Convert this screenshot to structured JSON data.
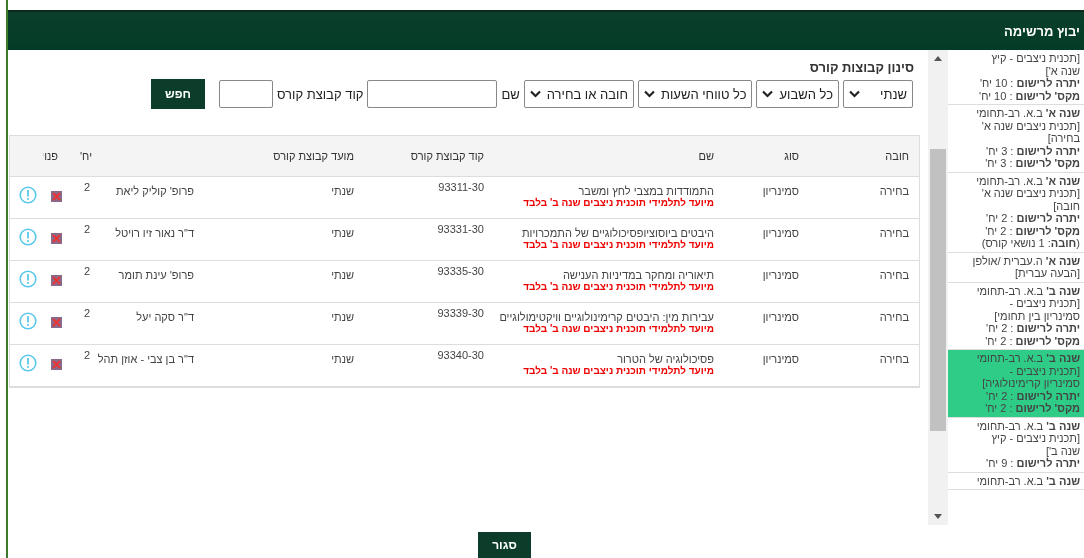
{
  "header": {
    "title": "יבוץ מרשימה"
  },
  "filters": {
    "title": "סינון קבוצות קורס",
    "selects": [
      {
        "value": "שנתי"
      },
      {
        "value": "כל השבוע"
      },
      {
        "value": "כל טווחי השעות"
      },
      {
        "value": "חובה או בחירה"
      }
    ],
    "name_field": {
      "label": "שם"
    },
    "code_field": {
      "label": "קוד קבוצת קורס"
    },
    "search_button": "חפש"
  },
  "table": {
    "columns": [
      "חובה",
      "סוג",
      "שם",
      "קוד קבוצת קורס",
      "מועד קבוצת קורס",
      "",
      "יח'",
      "פנוי",
      ""
    ],
    "rows": [
      {
        "requirement": "בחירה",
        "type": "סמינריון",
        "name": "התמודדות במצבי לחץ ומשבר",
        "note": "מיועד לתלמידי תוכנית ניצבים שנה ב' בלבד",
        "code": "93311-30",
        "schedule": "שנתי",
        "lecturer": "פרופ' קוליק ליאת",
        "credits": "2"
      },
      {
        "requirement": "בחירה",
        "type": "סמינריון",
        "name": "היבטים ביוסוציופסיכולוגיים של התמכרויות",
        "note": "מיועד לתלמידי תוכנית ניצבים שנה ב' בלבד",
        "code": "93331-30",
        "schedule": "שנתי",
        "lecturer": "ד\"ר נאור זיו רויטל",
        "credits": "2"
      },
      {
        "requirement": "בחירה",
        "type": "סמינריון",
        "name": "תיאוריה ומחקר במדיניות הענישה",
        "note": "מיועד לתלמידי תוכנית ניצבים שנה ב' בלבד",
        "code": "93335-30",
        "schedule": "שנתי",
        "lecturer": "פרופ' עינת תומר",
        "credits": "2"
      },
      {
        "requirement": "בחירה",
        "type": "סמינריון",
        "name": "עבירות מין: היבטים קרימינולוגיים וויקטימולוגיים",
        "note": "מיועד לתלמידי תוכנית ניצבים שנה ב' בלבד",
        "code": "93339-30",
        "schedule": "שנתי",
        "lecturer": "ד\"ר סקה יעל",
        "credits": "2"
      },
      {
        "requirement": "בחירה",
        "type": "סמינריון",
        "name": "פסיכולוגיה של הטרור",
        "note": "מיועד לתלמידי תוכנית ניצבים שנה ב' בלבד",
        "code": "93340-30",
        "schedule": "שנתי",
        "lecturer": "ד\"ר בן צבי - אוזן תהל",
        "credits": "2"
      }
    ]
  },
  "sidebar": {
    "items": [
      {
        "selected": false,
        "lines": [
          "[תכנית ניצבים - קיץ",
          "שנה א']",
          "**יתרה לרישום** : 10 יח'",
          "**מקס' לרישום** : 10 יח'"
        ]
      },
      {
        "selected": false,
        "lines": [
          "**שנה א'** ב.א. רב-תחומי",
          "[תכנית ניצבים שנה א'",
          "בחירה]",
          "**יתרה לרישום** : 3 יח'",
          "**מקס' לרישום** : 3 יח'"
        ]
      },
      {
        "selected": false,
        "lines": [
          "**שנה א'** ב.א. רב-תחומי",
          "[תכנית ניצבים שנה א'",
          "חובה]",
          "**יתרה לרישום** : 2 יח'",
          "**מקס' לרישום** : 2 יח'",
          "(**חובה**: 1 נושאי קורס)"
        ]
      },
      {
        "selected": false,
        "lines": [
          "**שנה א'** ה.עברית /אולפן",
          "[הבעה עברית]"
        ]
      },
      {
        "selected": false,
        "lines": [
          "**שנה ב'** ב.א. רב-תחומי",
          "[תכנית ניצבים -",
          "סמינריון בין תחומי]",
          "**יתרה לרישום** : 2 יח'",
          "**מקס' לרישום** : 2 יח'"
        ]
      },
      {
        "selected": true,
        "lines": [
          "**שנה ב'** ב.א. רב-תחומי",
          "[תכנית ניצבים -",
          "סמינריון קרימינולוגיה]",
          "**יתרה לרישום** : 2 יח'",
          "**מקס' לרישום** : 2 יח'"
        ]
      },
      {
        "selected": false,
        "lines": [
          "**שנה ב'** ב.א. רב-תחומי",
          "[תכנית ניצבים - קיץ",
          "שנה ב']",
          "**יתרה לרישום** : 9 יח'"
        ]
      },
      {
        "selected": false,
        "lines": [
          "**שנה ב'** ב.א. רב-תחומי"
        ]
      }
    ]
  },
  "close_button": "סגור"
}
